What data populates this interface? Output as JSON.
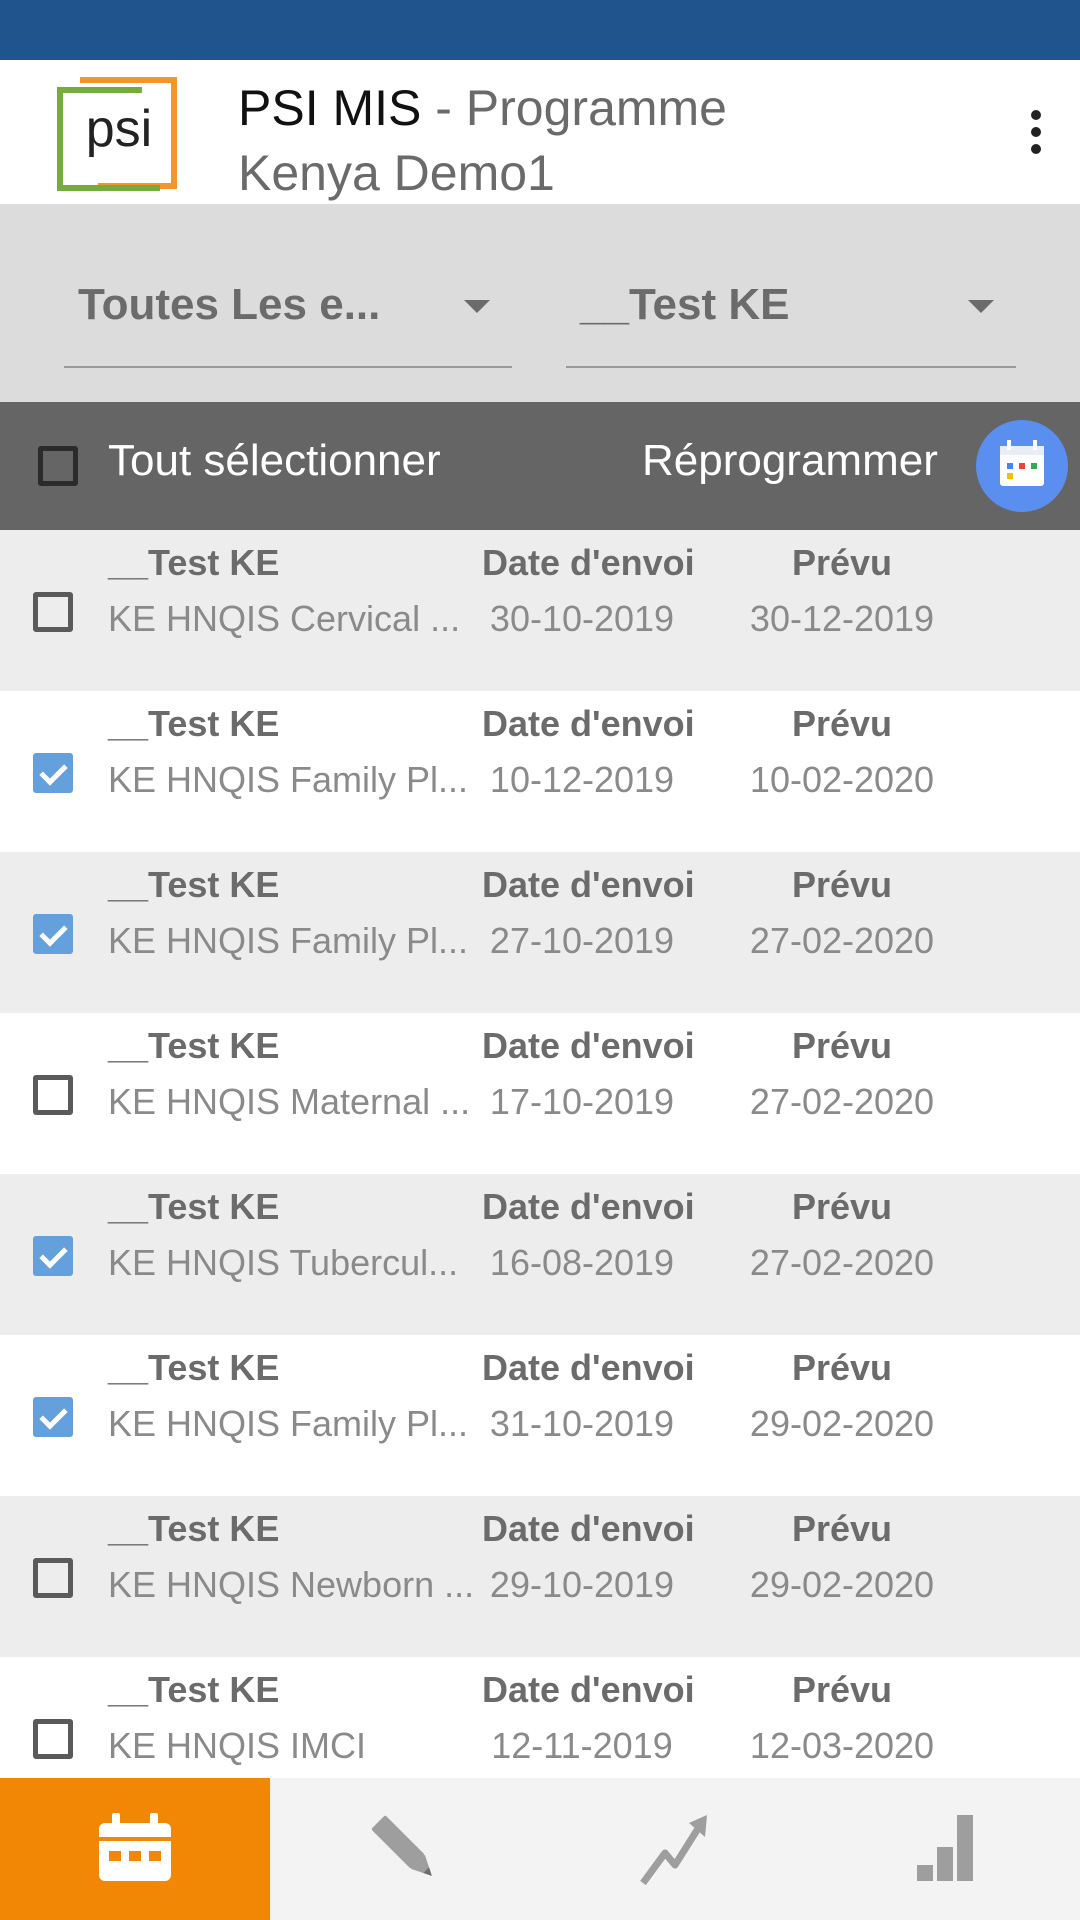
{
  "header": {
    "app_name": "PSI MIS",
    "title_suffix": " - Programme",
    "subtitle": "Kenya Demo1",
    "logo_text": "psi"
  },
  "filters": {
    "program_filter": "Toutes Les e...",
    "org_unit_filter": "__Test KE"
  },
  "actions": {
    "select_all_label": "Tout sélectionner",
    "reschedule_label": "Réprogrammer"
  },
  "list": {
    "date_header": "Date d'envoi",
    "due_header": "Prévu",
    "rows": [
      {
        "org": "__Test KE",
        "program": "KE HNQIS Cervical ...",
        "sent": "30-10-2019",
        "due": "30-12-2019",
        "checked": false
      },
      {
        "org": "__Test KE",
        "program": "KE HNQIS Family Pl...",
        "sent": "10-12-2019",
        "due": "10-02-2020",
        "checked": true
      },
      {
        "org": "__Test KE",
        "program": "KE HNQIS Family Pl...",
        "sent": "27-10-2019",
        "due": "27-02-2020",
        "checked": true
      },
      {
        "org": "__Test KE",
        "program": "KE HNQIS Maternal ...",
        "sent": "17-10-2019",
        "due": "27-02-2020",
        "checked": false
      },
      {
        "org": "__Test KE",
        "program": "KE HNQIS Tubercul...",
        "sent": "16-08-2019",
        "due": "27-02-2020",
        "checked": true
      },
      {
        "org": "__Test KE",
        "program": "KE HNQIS Family Pl...",
        "sent": "31-10-2019",
        "due": "29-02-2020",
        "checked": true
      },
      {
        "org": "__Test KE",
        "program": "KE HNQIS Newborn ...",
        "sent": "29-10-2019",
        "due": "29-02-2020",
        "checked": false
      },
      {
        "org": "__Test KE",
        "program": "KE HNQIS IMCI",
        "sent": "12-11-2019",
        "due": "12-03-2020",
        "checked": false
      }
    ]
  },
  "bottom_nav": {
    "tabs": [
      {
        "icon": "calendar-icon",
        "active": true
      },
      {
        "icon": "pencil-icon",
        "active": false
      },
      {
        "icon": "trend-icon",
        "active": false
      },
      {
        "icon": "bar-chart-icon",
        "active": false
      }
    ]
  },
  "colors": {
    "status_bar": "#1f548c",
    "active_tab": "#f28705",
    "fab": "#5a8ff0",
    "checkbox_checked": "#64a0dc"
  }
}
